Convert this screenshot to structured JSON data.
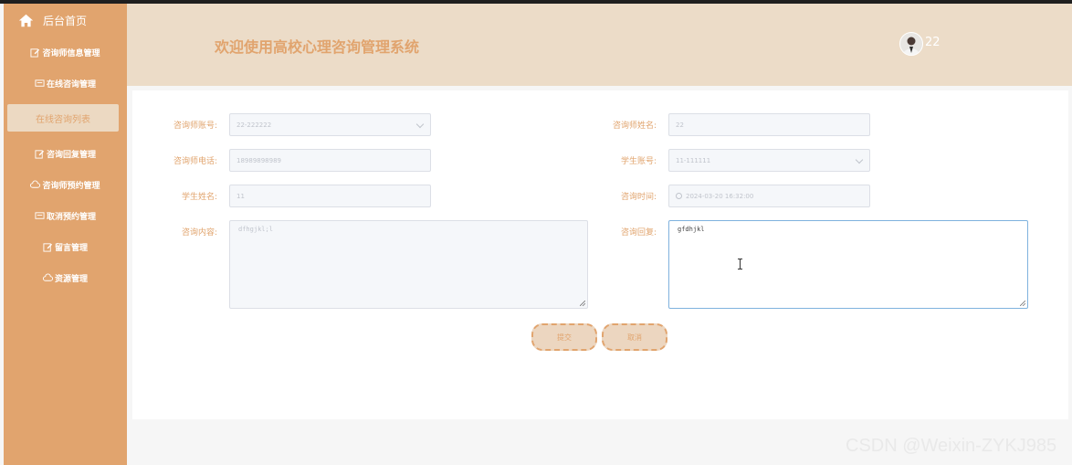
{
  "sidebar": {
    "home_label": "后台首页",
    "items": [
      {
        "label": "咨询师信息管理",
        "icon": "edit-icon"
      },
      {
        "label": "在线咨询管理",
        "icon": "chat-icon"
      },
      {
        "label": "在线咨询列表",
        "icon": "",
        "active": true
      },
      {
        "label": "咨询回复管理",
        "icon": "edit-icon"
      },
      {
        "label": "咨询师预约管理",
        "icon": "cloud-icon"
      },
      {
        "label": "取消预约管理",
        "icon": "chat-icon"
      },
      {
        "label": "留言管理",
        "icon": "edit-icon"
      },
      {
        "label": "资源管理",
        "icon": "cloud-icon"
      }
    ]
  },
  "header": {
    "title": "欢迎使用高校心理咨询管理系统",
    "username": "22"
  },
  "form": {
    "counselor_account": {
      "label": "咨询师账号:",
      "value": "22-222222"
    },
    "counselor_name": {
      "label": "咨询师姓名:",
      "value": "22"
    },
    "counselor_phone": {
      "label": "咨询师电话:",
      "value": "18989898989"
    },
    "student_account": {
      "label": "学生账号:",
      "value": "11-111111"
    },
    "student_name": {
      "label": "学生姓名:",
      "value": "11"
    },
    "consult_time": {
      "label": "咨询时间:",
      "value": "2024-03-20 16:32:00"
    },
    "consult_content": {
      "label": "咨询内容:",
      "value": "dfhgjkl;l"
    },
    "consult_reply": {
      "label": "咨询回复:",
      "value": "gfdhjkl"
    }
  },
  "buttons": {
    "submit": "提交",
    "cancel": "取消"
  },
  "watermark": "CSDN @Weixin-ZYKJ985",
  "colors": {
    "accent": "#e1a46e",
    "header_bg": "#ecdcc8",
    "active_item_bg": "#ecd9c2"
  }
}
